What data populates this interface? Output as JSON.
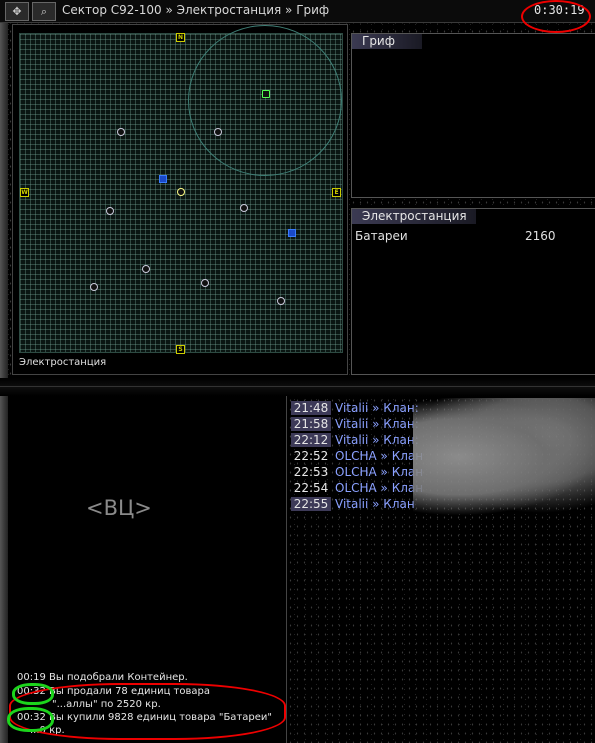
{
  "toolbar": {
    "nav_icon": "move-arrows-icon",
    "search_icon": "search-icon",
    "breadcrumb": "Сектор C92-100 » Электростанция » Гриф",
    "clock": "0:30:19"
  },
  "map": {
    "compass": {
      "n": "N",
      "s": "S",
      "w": "W",
      "e": "E"
    },
    "caption": "Электростанция"
  },
  "panels": {
    "grif": {
      "title": "Гриф"
    },
    "elec": {
      "title": "Электростанция",
      "cargo": [
        {
          "name": "Батареи",
          "qty": "2160"
        }
      ]
    }
  },
  "center": {
    "label": "<ВЦ>"
  },
  "log": [
    {
      "time": "00:19",
      "text": "Вы подобрали Контейнер."
    },
    {
      "time": "00:32",
      "text": "Вы продали 78 единиц товара"
    },
    {
      "time": "",
      "text": "\"...аллы\" по 2520 кр."
    },
    {
      "time": "00:32",
      "text": "Вы купили 9828 единиц товара \"Батареи\""
    },
    {
      "time": "",
      "text": "...0 кр."
    }
  ],
  "chat": [
    {
      "time": "21:48",
      "text": "Vitalii » Клан:"
    },
    {
      "time": "21:58",
      "text": "Vitalii » Клан:"
    },
    {
      "time": "22:12",
      "text": "Vitalii » Клан:"
    },
    {
      "time": "22:52",
      "text": "OLCHA » Клан"
    },
    {
      "time": "22:53",
      "text": "OLCHA » Клан"
    },
    {
      "time": "22:54",
      "text": "OLCHA » Клан"
    },
    {
      "time": "22:55",
      "text": "Vitalii » Клан"
    }
  ],
  "colors": {
    "annotation_red": "#ee0000",
    "annotation_green": "#1cd41c",
    "chat_name": "#8aa0ff",
    "highlight": "#3d3a58"
  }
}
